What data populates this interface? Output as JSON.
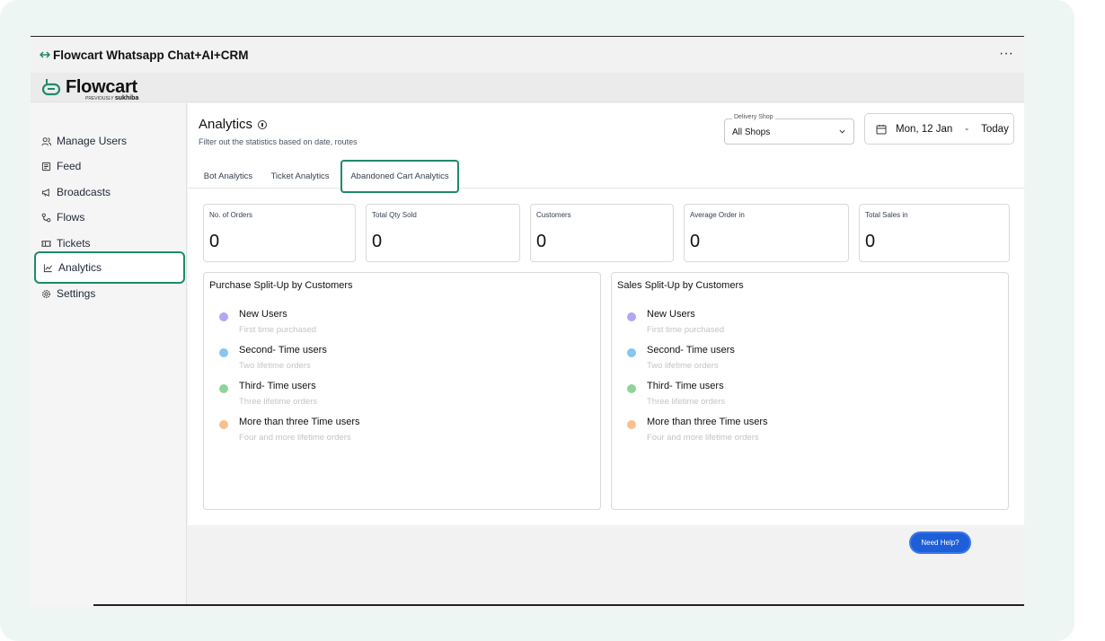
{
  "window": {
    "title": "Flowcart Whatsapp Chat+AI+CRM",
    "more": "···"
  },
  "logo": {
    "name": "Flowcart",
    "previously": "PREVIOUSLY",
    "old_name": "sukhiba"
  },
  "sidebar": {
    "items": [
      {
        "label": "Manage Users",
        "icon": "users-icon"
      },
      {
        "label": "Feed",
        "icon": "feed-icon"
      },
      {
        "label": "Broadcasts",
        "icon": "megaphone-icon"
      },
      {
        "label": "Flows",
        "icon": "flows-icon"
      },
      {
        "label": "Tickets",
        "icon": "ticket-icon"
      },
      {
        "label": "Analytics",
        "icon": "chart-icon",
        "active": true
      },
      {
        "label": "Settings",
        "icon": "gear-icon"
      }
    ]
  },
  "header": {
    "title": "Analytics",
    "subtitle": "Filter out the statistics based on date, routes",
    "shop_legend": "Delivery Shop",
    "shop_value": "All Shops",
    "date_from": "Mon, 12 Jan",
    "date_sep": "-",
    "date_to": "Today"
  },
  "tabs": [
    {
      "label": "Bot Analytics"
    },
    {
      "label": "Ticket Analytics"
    },
    {
      "label": "Abandoned Cart Analytics",
      "active": true
    }
  ],
  "stats": [
    {
      "label": "No. of Orders",
      "value": "0"
    },
    {
      "label": "Total Qty Sold",
      "value": "0"
    },
    {
      "label": "Customers",
      "value": "0"
    },
    {
      "label": "Average Order in",
      "value": "0"
    },
    {
      "label": "Total Sales in",
      "value": "0"
    }
  ],
  "panels": [
    {
      "title": "Purchase Split-Up by Customers",
      "items": [
        {
          "name": "New Users",
          "desc": "First time purchased",
          "color": "#b3a6f2"
        },
        {
          "name": "Second- Time users",
          "desc": "Two lifetime orders",
          "color": "#86c5f4"
        },
        {
          "name": "Third- Time users",
          "desc": "Three lifetime orders",
          "color": "#8fd39a"
        },
        {
          "name": "More than three Time users",
          "desc": "Four and more lifetime orders",
          "color": "#f9c08f"
        }
      ]
    },
    {
      "title": "Sales Split-Up by Customers",
      "items": [
        {
          "name": "New Users",
          "desc": "First time purchased",
          "color": "#b3a6f2"
        },
        {
          "name": "Second- Time users",
          "desc": "Two lifetime orders",
          "color": "#86c5f4"
        },
        {
          "name": "Third- Time users",
          "desc": "Three lifetime orders",
          "color": "#8fd39a"
        },
        {
          "name": "More than three Time users",
          "desc": "Four and more lifetime orders",
          "color": "#f9c08f"
        }
      ]
    }
  ],
  "help": {
    "label": "Need Help?"
  },
  "colors": {
    "accent": "#1f8a6a",
    "help_button": "#1e5ed8"
  }
}
